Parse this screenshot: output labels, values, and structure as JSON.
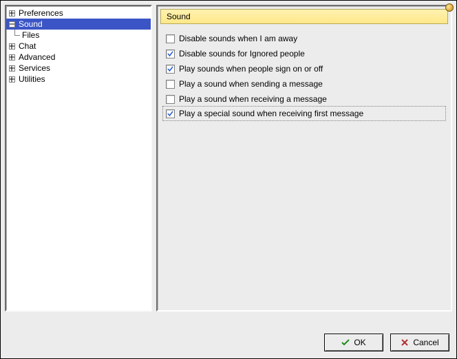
{
  "tree": {
    "items": [
      {
        "label": "Preferences",
        "expander": "plus",
        "selected": false
      },
      {
        "label": "Sound",
        "expander": "minus",
        "selected": true
      },
      {
        "label": "Files",
        "expander": "none",
        "selected": false,
        "child": true
      },
      {
        "label": "Chat",
        "expander": "plus",
        "selected": false
      },
      {
        "label": "Advanced",
        "expander": "plus",
        "selected": false
      },
      {
        "label": "Services",
        "expander": "plus",
        "selected": false
      },
      {
        "label": "Utilities",
        "expander": "plus",
        "selected": false
      }
    ]
  },
  "panel": {
    "title": "Sound",
    "options": [
      {
        "label": "Disable sounds when I am away",
        "checked": false,
        "focused": false
      },
      {
        "label": "Disable sounds for Ignored people",
        "checked": true,
        "focused": false
      },
      {
        "label": "Play sounds when people sign on or off",
        "checked": true,
        "focused": false
      },
      {
        "label": "Play a sound when sending a message",
        "checked": false,
        "focused": false
      },
      {
        "label": "Play a sound when receiving a message",
        "checked": false,
        "focused": false
      },
      {
        "label": "Play a special sound when receiving first message",
        "checked": true,
        "focused": true
      }
    ]
  },
  "buttons": {
    "ok": "OK",
    "cancel": "Cancel"
  }
}
